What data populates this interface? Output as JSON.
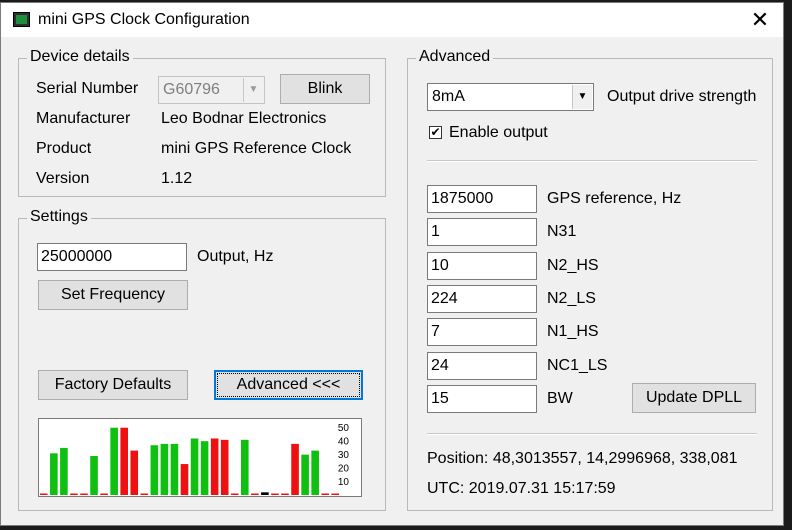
{
  "window": {
    "title": "mini GPS Clock Configuration",
    "close_glyph": "✕"
  },
  "device": {
    "legend": "Device details",
    "serial_label": "Serial Number",
    "serial_value": "G60796",
    "blink_label": "Blink",
    "manufacturer_label": "Manufacturer",
    "manufacturer_value": "Leo Bodnar Electronics",
    "product_label": "Product",
    "product_value": "mini GPS Reference Clock",
    "version_label": "Version",
    "version_value": "1.12"
  },
  "settings": {
    "legend": "Settings",
    "output_value": "25000000",
    "output_label": "Output, Hz",
    "set_frequency_label": "Set Frequency",
    "factory_defaults_label": "Factory Defaults",
    "advanced_label": "Advanced <<<"
  },
  "advanced": {
    "legend": "Advanced",
    "drive_value": "8mA",
    "drive_label": "Output drive strength",
    "enable_label": "Enable output",
    "enable_checked": "✔",
    "fields": [
      {
        "value": "1875000",
        "label": "GPS reference, Hz"
      },
      {
        "value": "1",
        "label": "N31"
      },
      {
        "value": "10",
        "label": "N2_HS"
      },
      {
        "value": "224",
        "label": "N2_LS"
      },
      {
        "value": "7",
        "label": "N1_HS"
      },
      {
        "value": "24",
        "label": "NC1_LS"
      },
      {
        "value": "15",
        "label": "BW"
      }
    ],
    "update_label": "Update DPLL",
    "position_text": "Position: 48,3013557, 14,2996968, 338,081",
    "utc_text": "UTC: 2019.07.31 15:17:59"
  },
  "chart_data": {
    "type": "bar",
    "ylim": [
      0,
      55
    ],
    "ticks": [
      "50",
      "40",
      "30",
      "20",
      "10"
    ],
    "tick_values": [
      50,
      40,
      30,
      20,
      10
    ],
    "colors": {
      "green": "#10c010",
      "red": "#ee1111",
      "black": "#000000"
    },
    "bars": [
      {
        "value": 1,
        "color": "red"
      },
      {
        "value": 31,
        "color": "green"
      },
      {
        "value": 35,
        "color": "green"
      },
      {
        "value": 1,
        "color": "red"
      },
      {
        "value": 1,
        "color": "red"
      },
      {
        "value": 29,
        "color": "green"
      },
      {
        "value": 1,
        "color": "red"
      },
      {
        "value": 50,
        "color": "green"
      },
      {
        "value": 50,
        "color": "red"
      },
      {
        "value": 33,
        "color": "red"
      },
      {
        "value": 1,
        "color": "red"
      },
      {
        "value": 37,
        "color": "green"
      },
      {
        "value": 38,
        "color": "green"
      },
      {
        "value": 38,
        "color": "green"
      },
      {
        "value": 23,
        "color": "red"
      },
      {
        "value": 42,
        "color": "green"
      },
      {
        "value": 40,
        "color": "green"
      },
      {
        "value": 42,
        "color": "red"
      },
      {
        "value": 41,
        "color": "red"
      },
      {
        "value": 1,
        "color": "red"
      },
      {
        "value": 41,
        "color": "green"
      },
      {
        "value": 1,
        "color": "red"
      },
      {
        "value": 2,
        "color": "black"
      },
      {
        "value": 1,
        "color": "red"
      },
      {
        "value": 1,
        "color": "red"
      },
      {
        "value": 38,
        "color": "red"
      },
      {
        "value": 30,
        "color": "green"
      },
      {
        "value": 33,
        "color": "green"
      },
      {
        "value": 1,
        "color": "red"
      },
      {
        "value": 1,
        "color": "red"
      }
    ]
  }
}
